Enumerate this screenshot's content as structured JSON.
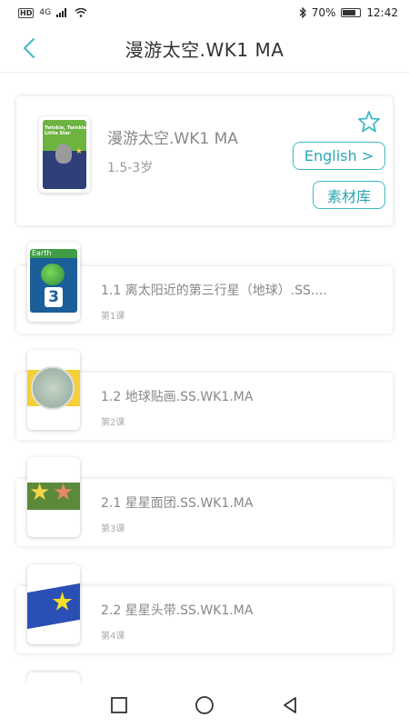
{
  "status_bar": {
    "left_badge": "HD",
    "signal_text": "4G",
    "battery": "70%",
    "time": "12:42"
  },
  "header": {
    "title": "漫游太空.WK1 MA",
    "back_icon": "chevron-left-icon"
  },
  "course": {
    "name": "漫游太空.WK1 MA",
    "age": "1.5-3岁",
    "english_button": "English >",
    "material_button": "素材库",
    "favorite_icon": "star-outline-icon",
    "cover_text": "Twinkle, Twinkle Little Star",
    "accent_color": "#3fb9c4"
  },
  "lessons": [
    {
      "title": "1.1 离太阳近的第三行星（地球）.SS....",
      "sub": "第1课",
      "thumb_text": "Earth",
      "thumb_number": "3"
    },
    {
      "title": "1.2 地球贴画.SS.WK1.MA",
      "sub": "第2课"
    },
    {
      "title": "2.1 星星面团.SS.WK1.MA",
      "sub": "第3课"
    },
    {
      "title": "2.2 星星头带.SS.WK1.MA",
      "sub": "第4课"
    }
  ],
  "nav": {
    "recent": "square-icon",
    "home": "circle-icon",
    "back": "triangle-back-icon"
  }
}
